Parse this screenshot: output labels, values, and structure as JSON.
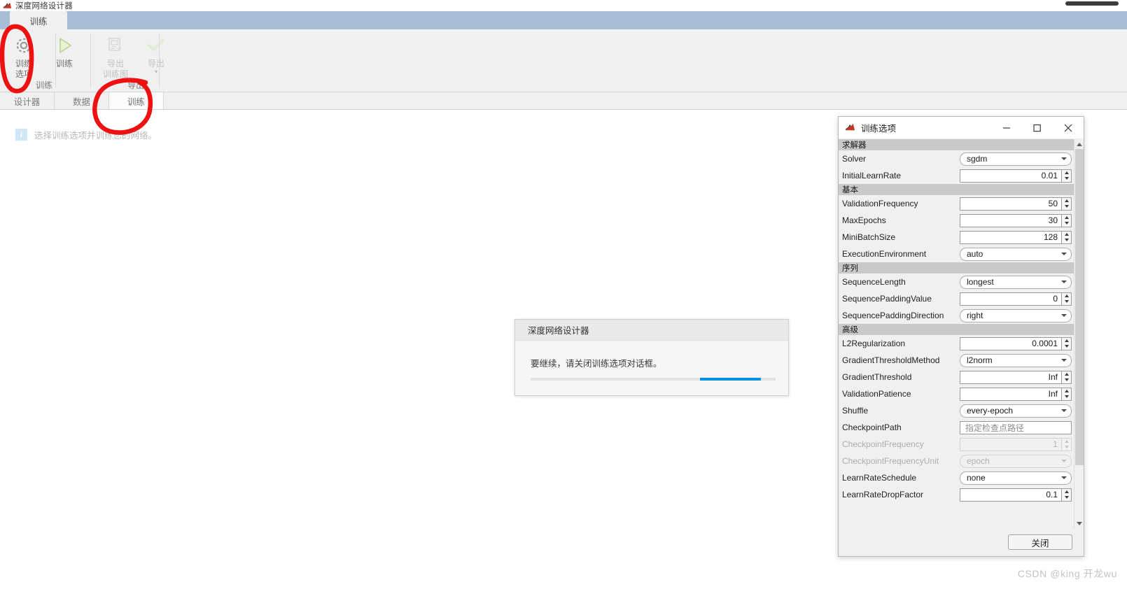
{
  "app": {
    "title": "深度网络设计器",
    "logo_icon": "matlab-logo-icon"
  },
  "ribbon": {
    "tab_label": "训练",
    "groups": [
      {
        "label": "训练",
        "items": [
          {
            "caption": "训练\n选项",
            "icon": "gear-icon",
            "disabled": false
          },
          {
            "caption": "训练",
            "icon": "play-triangle-icon",
            "disabled": false
          }
        ]
      },
      {
        "label": "导出",
        "items": [
          {
            "caption": "导出\n训练图",
            "icon": "export-chart-icon",
            "disabled": true
          },
          {
            "caption": "导出",
            "icon": "checkmark-icon",
            "disabled": true,
            "has_caret": true
          }
        ]
      }
    ]
  },
  "lower_tabs": [
    {
      "label": "设计器",
      "active": false
    },
    {
      "label": "数据",
      "active": false
    },
    {
      "label": "训练",
      "active": true
    }
  ],
  "info_strip": {
    "icon": "info-icon",
    "text": "选择训练选项并训练您的网络。"
  },
  "modal": {
    "title": "深度网络设计器",
    "message": "要继续，请关闭训练选项对话框。",
    "progress": {
      "indeterminate": true,
      "chunk_start_percent": 69,
      "chunk_width_percent": 25,
      "color": "#0b8fe0"
    }
  },
  "options_dialog": {
    "title": "训练选项",
    "logo_icon": "matlab-logo-icon",
    "window_controls": [
      {
        "name": "minimize-button",
        "glyph": "minimize-icon"
      },
      {
        "name": "maximize-button",
        "glyph": "maximize-icon"
      },
      {
        "name": "close-button",
        "glyph": "close-icon"
      }
    ],
    "sections": [
      {
        "header": "求解器",
        "rows": [
          {
            "label": "Solver",
            "type": "combo",
            "value": "sgdm",
            "disabled": false
          },
          {
            "label": "InitialLearnRate",
            "type": "spin",
            "value": "0.01",
            "disabled": false
          }
        ]
      },
      {
        "header": "基本",
        "rows": [
          {
            "label": "ValidationFrequency",
            "type": "spin",
            "value": "50",
            "disabled": false
          },
          {
            "label": "MaxEpochs",
            "type": "spin",
            "value": "30",
            "disabled": false
          },
          {
            "label": "MiniBatchSize",
            "type": "spin",
            "value": "128",
            "disabled": false
          },
          {
            "label": "ExecutionEnvironment",
            "type": "combo",
            "value": "auto",
            "disabled": false
          }
        ]
      },
      {
        "header": "序列",
        "rows": [
          {
            "label": "SequenceLength",
            "type": "combo",
            "value": "longest",
            "disabled": false
          },
          {
            "label": "SequencePaddingValue",
            "type": "spin",
            "value": "0",
            "disabled": false
          },
          {
            "label": "SequencePaddingDirection",
            "type": "combo",
            "value": "right",
            "disabled": false
          }
        ]
      },
      {
        "header": "高级",
        "rows": [
          {
            "label": "L2Regularization",
            "type": "spin",
            "value": "0.0001",
            "disabled": false
          },
          {
            "label": "GradientThresholdMethod",
            "type": "combo",
            "value": "l2norm",
            "disabled": false
          },
          {
            "label": "GradientThreshold",
            "type": "spin",
            "value": "Inf",
            "disabled": false
          },
          {
            "label": "ValidationPatience",
            "type": "spin",
            "value": "Inf",
            "disabled": false
          },
          {
            "label": "Shuffle",
            "type": "combo",
            "value": "every-epoch",
            "disabled": false
          },
          {
            "label": "CheckpointPath",
            "type": "textbox",
            "value": "",
            "placeholder": "指定检查点路径",
            "disabled": false
          },
          {
            "label": "CheckpointFrequency",
            "type": "spin",
            "value": "1",
            "disabled": true
          },
          {
            "label": "CheckpointFrequencyUnit",
            "type": "combo",
            "value": "epoch",
            "disabled": true
          },
          {
            "label": "LearnRateSchedule",
            "type": "combo",
            "value": "none",
            "disabled": false
          },
          {
            "label": "LearnRateDropFactor",
            "type": "spin",
            "value": "0.1",
            "disabled": false
          }
        ]
      }
    ],
    "close_button_label": "关闭"
  },
  "annotations": {
    "color": "#ee1111",
    "marks": [
      {
        "name": "circle-around-training-options",
        "shape": "ellipse"
      },
      {
        "name": "circle-around-training-tab",
        "shape": "ellipse"
      }
    ]
  },
  "watermark": {
    "text": "CSDN @king 开龙wu"
  }
}
